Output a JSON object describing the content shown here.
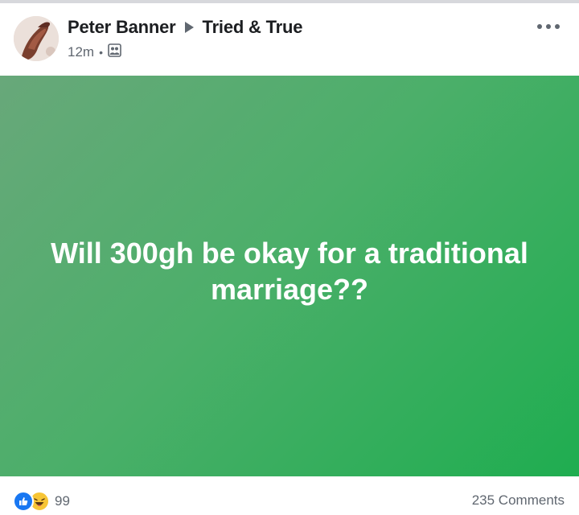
{
  "post": {
    "author": "Peter Banner",
    "group": "Tried & True",
    "timestamp": "12m",
    "separator": "•",
    "audience_icon": "group-audience-icon",
    "more_icon": "more-options-icon",
    "text": "Will 300gh be okay for a traditional marriage??",
    "background_colors": [
      "#68a87a",
      "#1fad50"
    ]
  },
  "footer": {
    "reaction_icons": [
      "like-icon",
      "haha-icon"
    ],
    "reaction_count": "99",
    "comments": "235 Comments"
  },
  "colors": {
    "like": "#1877f2",
    "haha": "#f7c536",
    "text_secondary": "#606770"
  }
}
